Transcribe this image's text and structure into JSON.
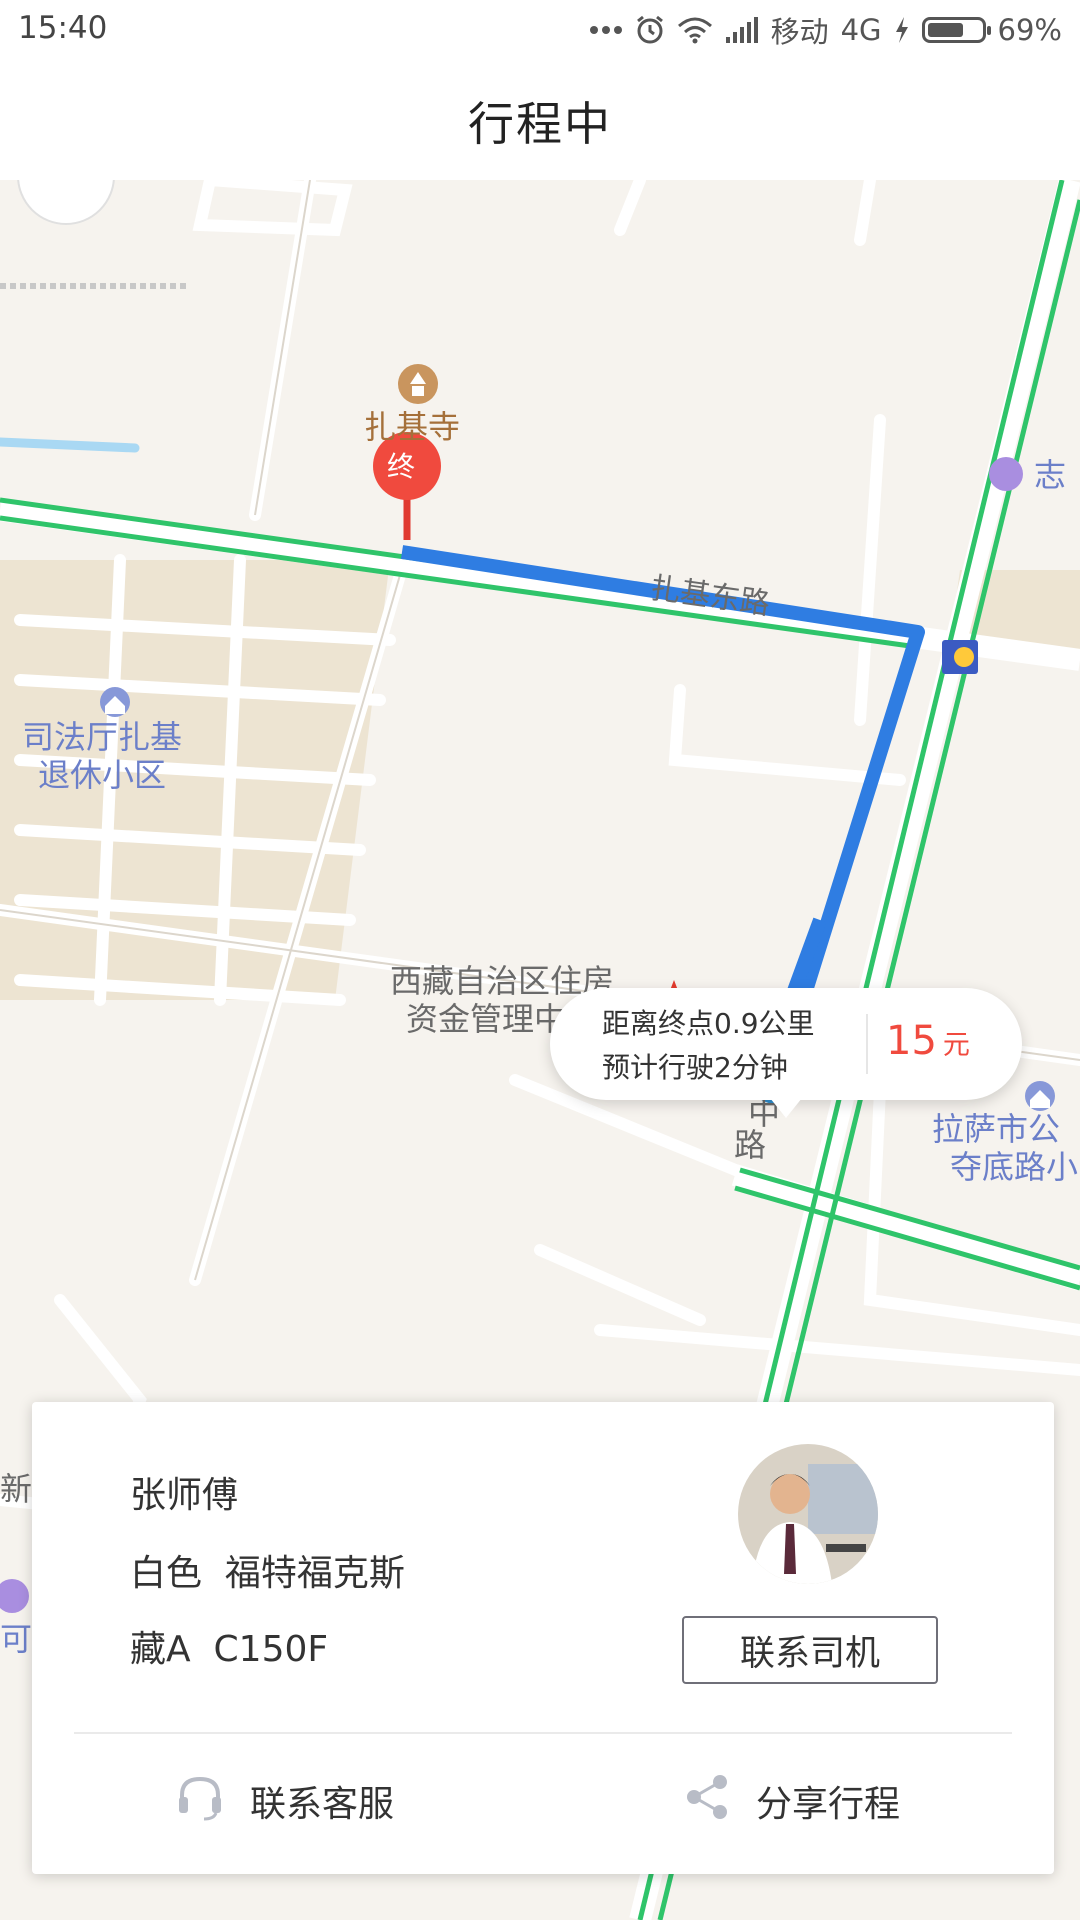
{
  "status_bar": {
    "time": "15:40",
    "carrier": "移动",
    "network": "4G",
    "battery_text": "69%",
    "battery_level": 0.69,
    "icons": [
      "more-dots-icon",
      "alarm-icon",
      "wifi-icon",
      "signal-icon",
      "charging-icon",
      "battery-icon"
    ]
  },
  "header": {
    "title": "行程中"
  },
  "map": {
    "labels": {
      "temple": "扎基寺",
      "road_east": "扎基东路",
      "community_1": "司法厅扎基",
      "community_2": "退休小区",
      "housing_1": "西藏自治区住房",
      "housing_2": "资金管理中心",
      "lhasa_1": "拉萨市公",
      "lhasa_2": "夺底路小",
      "zhi": "志",
      "road_mid": "中",
      "road_lu": "路",
      "left_xin": "新",
      "left_ke": "可"
    },
    "destination_marker": "终",
    "colors": {
      "route": "#2f7de2",
      "road_green": "#2fc46a",
      "marker": "#f04a3e",
      "car": "#2f8fd0"
    }
  },
  "eta_bubble": {
    "distance_text": "距离终点0.9公里",
    "time_text": "预计行驶2分钟",
    "fare_value": "15",
    "fare_unit": "元"
  },
  "driver_card": {
    "driver_name": "张师傅",
    "car_color": "白色",
    "car_model": "福特福克斯",
    "plate_prefix": "藏A",
    "plate_number": "C150F",
    "contact_driver": "联系司机",
    "customer_service": "联系客服",
    "share_trip": "分享行程"
  }
}
